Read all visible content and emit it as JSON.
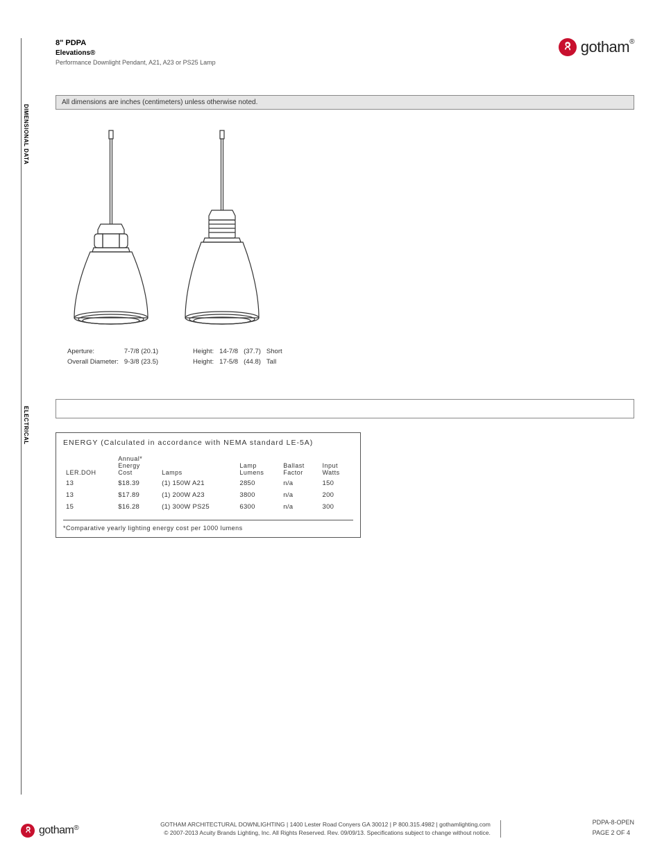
{
  "brand": "gotham",
  "header": {
    "title": "8\" PDPA",
    "subtitle_base": "Elevations",
    "subtitle_reg": "®",
    "desc": "Performance Downlight Pendant, A21, A23 or PS25 Lamp"
  },
  "sections": {
    "dimensional": "DIMENSIONAL DATA",
    "electrical": "ELECTRICAL"
  },
  "note": "All dimensions are inches (centimeters) unless otherwise noted.",
  "dims": {
    "left": [
      {
        "label": "Aperture:",
        "value": "7-7/8 (20.1)"
      },
      {
        "label": "Overall Diameter:",
        "value": "9-3/8 (23.5)"
      }
    ],
    "right": [
      {
        "label": "Height:",
        "v1": "14-7/8",
        "v2": "(37.7)",
        "v3": "Short"
      },
      {
        "label": "Height:",
        "v1": "17-5/8",
        "v2": "(44.8)",
        "v3": "Tall"
      }
    ]
  },
  "energy": {
    "title_strong": "ENERGY",
    "title_rest": "(Calculated in accordance with NEMA standard  LE-5A)",
    "headers": {
      "c1": "LER.DOH",
      "c2a": "Annual*",
      "c2b": "Energy",
      "c2c": "Cost",
      "c3": "Lamps",
      "c4a": "Lamp",
      "c4b": "Lumens",
      "c5a": "Ballast",
      "c5b": "Factor",
      "c6a": "Input",
      "c6b": "Watts"
    },
    "rows": [
      {
        "ler": "13",
        "cost": "$18.39",
        "lamps": "(1) 150W A21",
        "lumens": "2850",
        "bf": "n/a",
        "watts": "150"
      },
      {
        "ler": "13",
        "cost": "$17.89",
        "lamps": "(1) 200W A23",
        "lumens": "3800",
        "bf": "n/a",
        "watts": "200"
      },
      {
        "ler": "15",
        "cost": "$16.28",
        "lamps": "(1) 300W PS25",
        "lumens": "6300",
        "bf": "n/a",
        "watts": "300"
      }
    ],
    "footnote": "*Comparative yearly lighting energy cost per 1000 lumens"
  },
  "footer": {
    "line1": "GOTHAM ARCHITECTURAL DOWNLIGHTING  |  1400 Lester Road Conyers GA 30012  |  P 800.315.4982  |  gothamlighting.com",
    "line2": "© 2007-2013 Acuity Brands Lighting, Inc. All Rights Reserved. Rev. 09/09/13. Specifications subject to change without notice.",
    "code": "PDPA-8-OPEN",
    "page": "PAGE 2 OF 4"
  }
}
